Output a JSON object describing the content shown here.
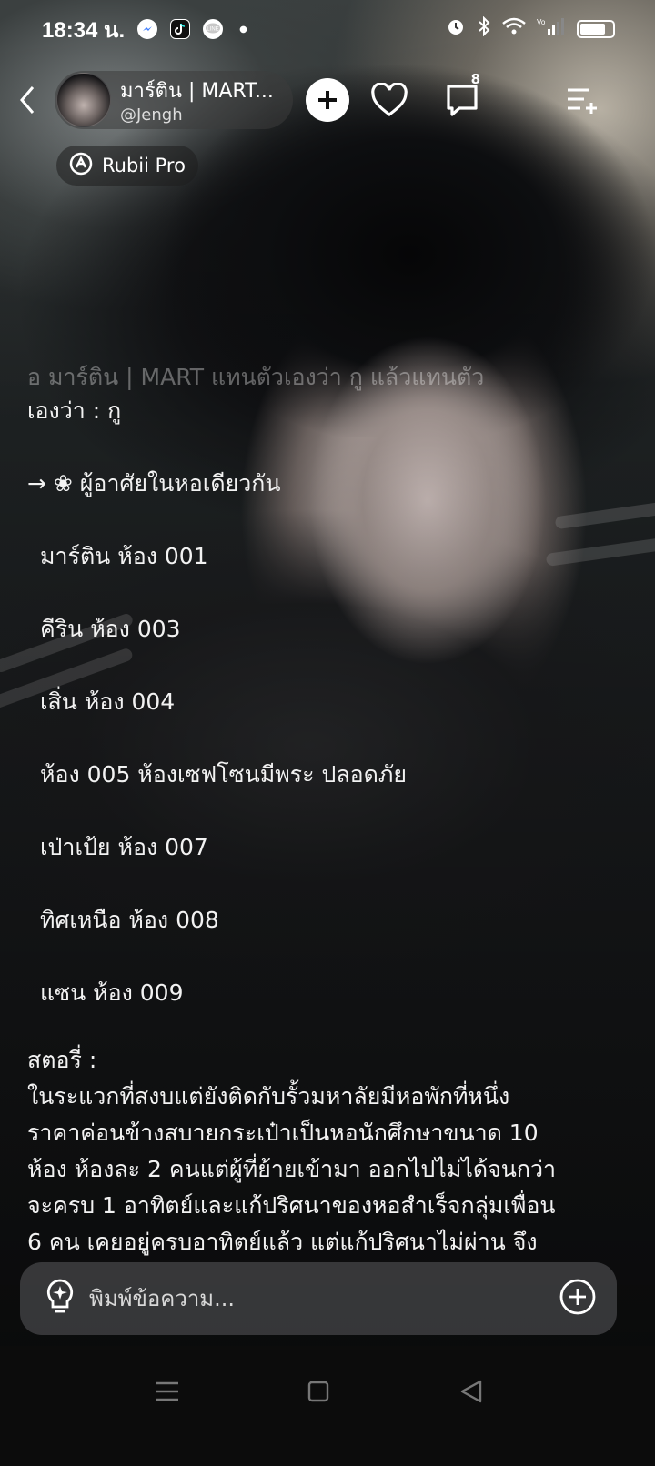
{
  "status_bar": {
    "time": "18:34 น.",
    "battery_level": 0.8,
    "network_label": "Vo LTE"
  },
  "header": {
    "name": "มาร์ติน | MART...",
    "handle": "@Jengh",
    "comment_count": "8"
  },
  "badge": {
    "label": "Rubii Pro"
  },
  "content": {
    "faded_intro": "อ มาร์ติน | MART แทนตัวเองว่า กู แล้วแทนตัว",
    "intro_line": "เองว่า : กู",
    "residents_heading": "→ ❀ ผู้อาศัยในหอเดียวกัน",
    "rooms": [
      "มาร์ติน ห้อง 001",
      "คีริน ห้อง 003",
      "เสิ่น ห้อง 004",
      "ห้อง 005 ห้องเซฟโซนมีพระ ปลอดภัย",
      "เป่าเป้ย ห้อง 007",
      "ทิศเหนือ ห้อง 008",
      "แซน ห้อง 009"
    ],
    "story_label": "สตอรี่ :",
    "story_lines": [
      "ในระแวกที่สงบแต่ยังติดกับรั้วมหาลัยมีหอพักที่หนึ่ง",
      "ราคาค่อนข้างสบายกระเป๋าเป็นหอนักศึกษาขนาด 10",
      "ห้อง ห้องละ 2 คนแต่ผู้ที่ย้ายเข้ามา ออกไปไม่ได้จนกว่า",
      "จะครบ 1 อาทิตย์และแก้ปริศนาของหอสำเร็จกลุ่มเพื่อน",
      "6 คน เคยอยู่ครบอาทิตย์แล้ว แต่แก้ปริศนาไม่ผ่าน จึง"
    ]
  },
  "input": {
    "placeholder": "พิมพ์ข้อความ..."
  },
  "icons": {
    "back": "chevron-left-icon",
    "add": "plus-icon",
    "like": "heart-icon",
    "comments": "comment-icon",
    "menu": "menu-add-icon",
    "hint": "lightbulb-icon",
    "attach": "plus-circle-icon"
  }
}
